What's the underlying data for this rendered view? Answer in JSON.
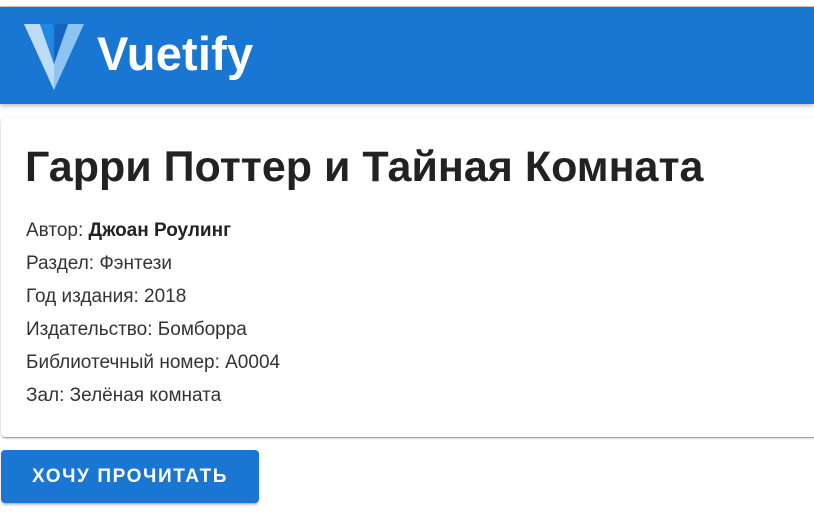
{
  "app_bar": {
    "brand": "Vuetify",
    "logo_icon": "vuetify-logo-icon",
    "color": "#1976d2"
  },
  "book": {
    "title": "Гарри Поттер и Тайная Комната",
    "author_label": "Автор: ",
    "author": "Джоан Роулинг",
    "section": "Раздел: Фэнтези",
    "year": "Год издания: 2018",
    "publisher": "Издательство: Бомборра",
    "library_number": "Библиотечный номер: A0004",
    "hall": "Зал: Зелёная комната"
  },
  "actions": {
    "want_to_read": "Хочу прочитать",
    "button_color": "#1976d2"
  }
}
